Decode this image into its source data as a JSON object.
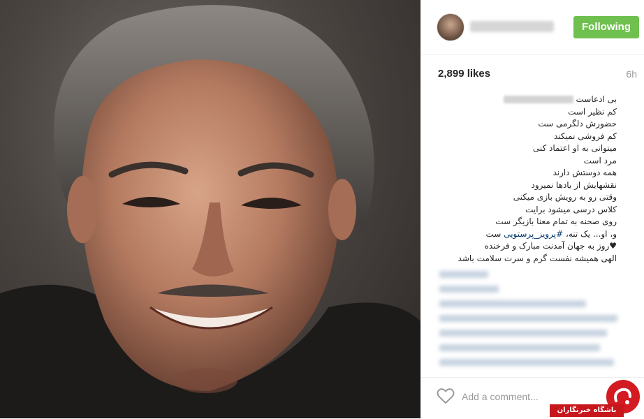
{
  "header": {
    "follow_label": "Following"
  },
  "post": {
    "likes": "2,899 likes",
    "time": "6h",
    "caption_first_suffix": "بی ادعاست",
    "caption_lines": [
      "کم نظیر است",
      "حضورش دلگرمی ست",
      "کم فروشی نمیکند",
      "میتوانی به او اعتماد کنی",
      "مرد است",
      "همه دوستش دارند",
      "نقشهایش از یادها نمیرود",
      "وقتی رو به رویش بازی میکنی",
      "کلاس درسی میشود برایت",
      "روی صحنه به تمام معنا بازیگر ست"
    ],
    "caption_hashtag_prefix": "و، او... یک تنه،",
    "caption_hashtag": "#پرویز_پرستویی",
    "caption_hashtag_suffix": "ست",
    "caption_birthday": "♥روز به جهان آمدنت مبارک و فرخنده",
    "caption_wish": "الهی همیشه نفست گرم و سرت سلامت باشد"
  },
  "comment": {
    "placeholder": "Add a comment..."
  },
  "watermark": {
    "label": "باشگاه خبرنگاران"
  },
  "colors": {
    "follow_button": "#70c050",
    "hashtag": "#003569",
    "watermark_red": "#c8161d"
  },
  "icons": {
    "like": "heart-outline-icon"
  }
}
